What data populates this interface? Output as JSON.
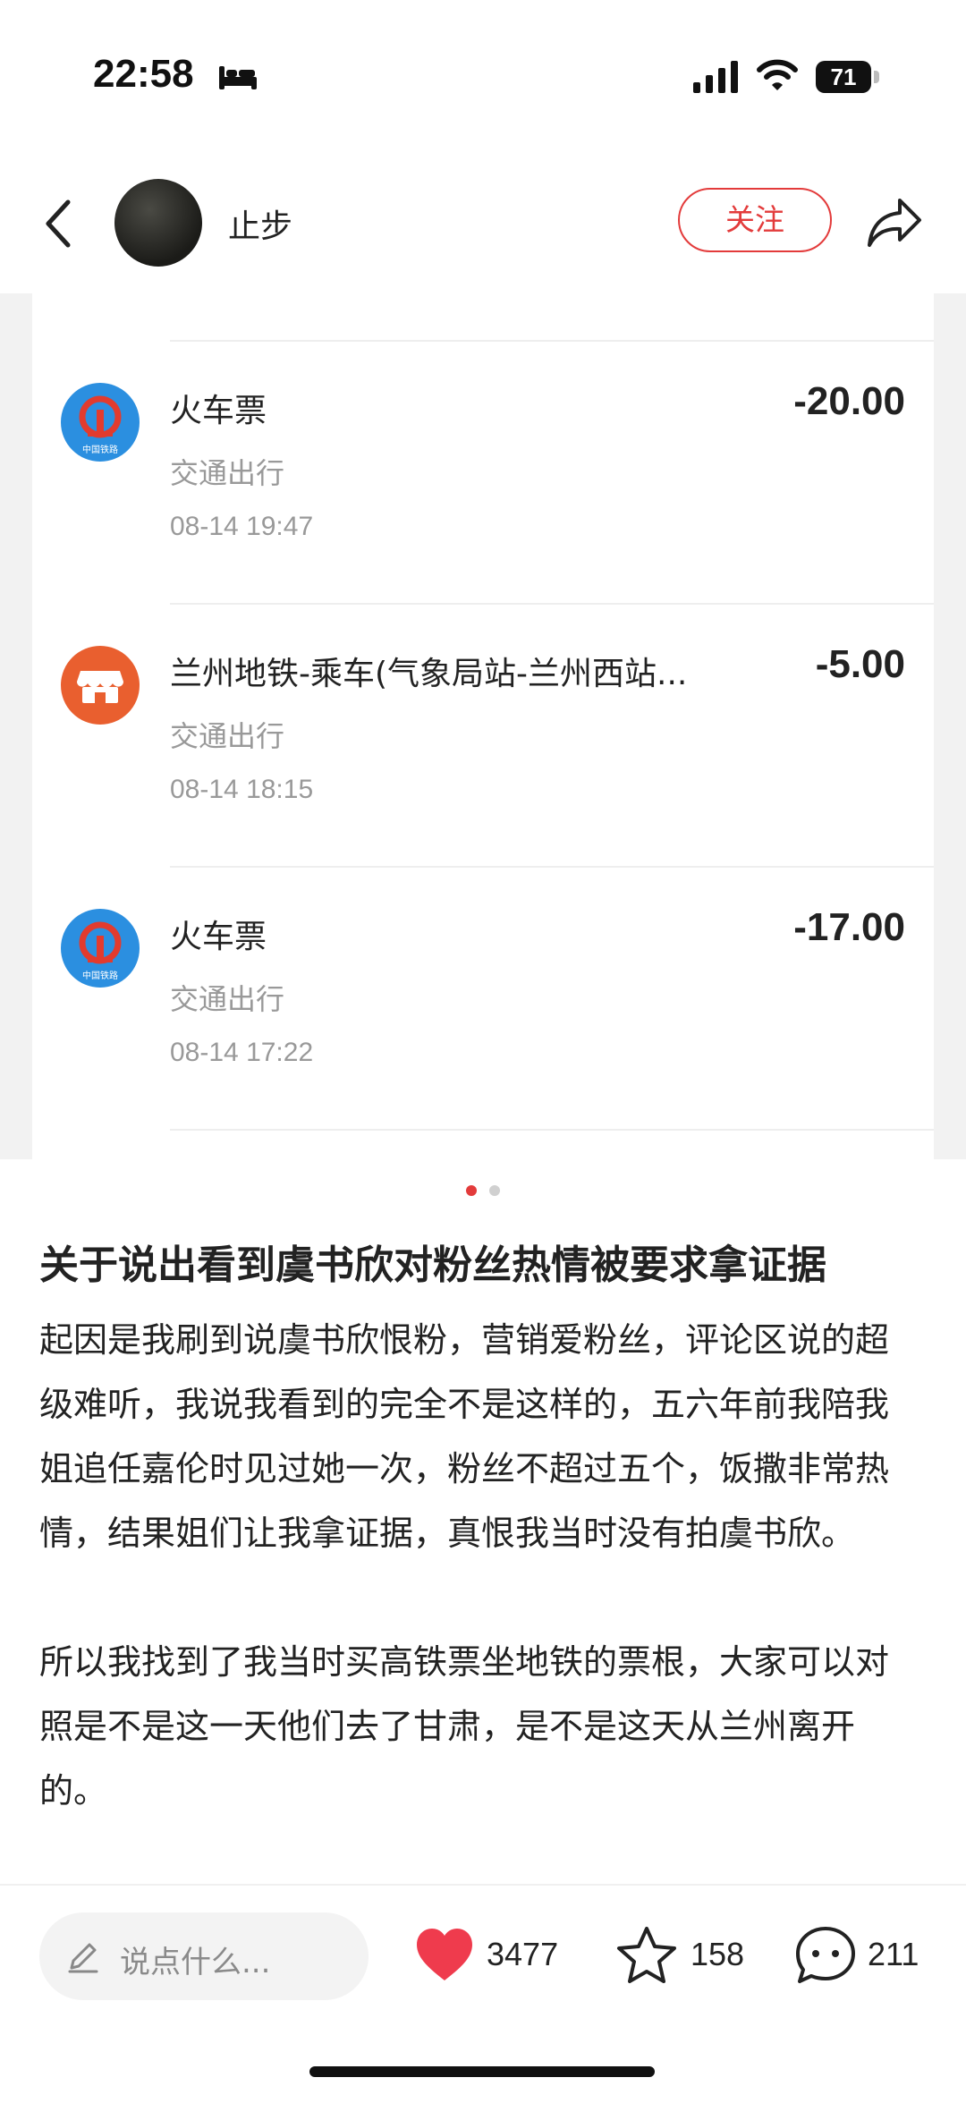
{
  "status_bar": {
    "time": "22:58",
    "battery": "71"
  },
  "header": {
    "username": "止步",
    "follow_label": "关注"
  },
  "transactions": [
    {
      "icon": "china-railway-icon",
      "title": "火车票",
      "amount": "-20.00",
      "category": "交通出行",
      "time": "08-14 19:47",
      "icon_text": "中国铁路"
    },
    {
      "icon": "store-icon",
      "title": "兰州地铁-乘车(气象局站-兰州西站...",
      "amount": "-5.00",
      "category": "交通出行",
      "time": "08-14 18:15"
    },
    {
      "icon": "china-railway-icon",
      "title": "火车票",
      "amount": "-17.00",
      "category": "交通出行",
      "time": "08-14 17:22",
      "icon_text": "中国铁路"
    }
  ],
  "pager": {
    "total": 2,
    "active": 1
  },
  "post": {
    "title": "关于说出看到虞书欣对粉丝热情被要求拿证据",
    "paragraphs": [
      "起因是我刷到说虞书欣恨粉，营销爱粉丝，评论区说的超级难听，我说我看到的完全不是这样的，五六年前我陪我姐追任嘉伦时见过她一次，粉丝不超过五个，饭撒非常热情，结果姐们让我拿证据，真恨我当时没有拍虞书欣。",
      "所以我找到了我当时买高铁票坐地铁的票根，大家可以对照是不是这一天他们去了甘肃，是不是这天从兰州离开的。"
    ]
  },
  "bottom_bar": {
    "comment_placeholder": "说点什么...",
    "likes": "3477",
    "favorites": "158",
    "comments": "211"
  },
  "colors": {
    "accent": "#e33b3b",
    "rail_blue": "#2b8fe0",
    "store_orange": "#e95f2f"
  }
}
